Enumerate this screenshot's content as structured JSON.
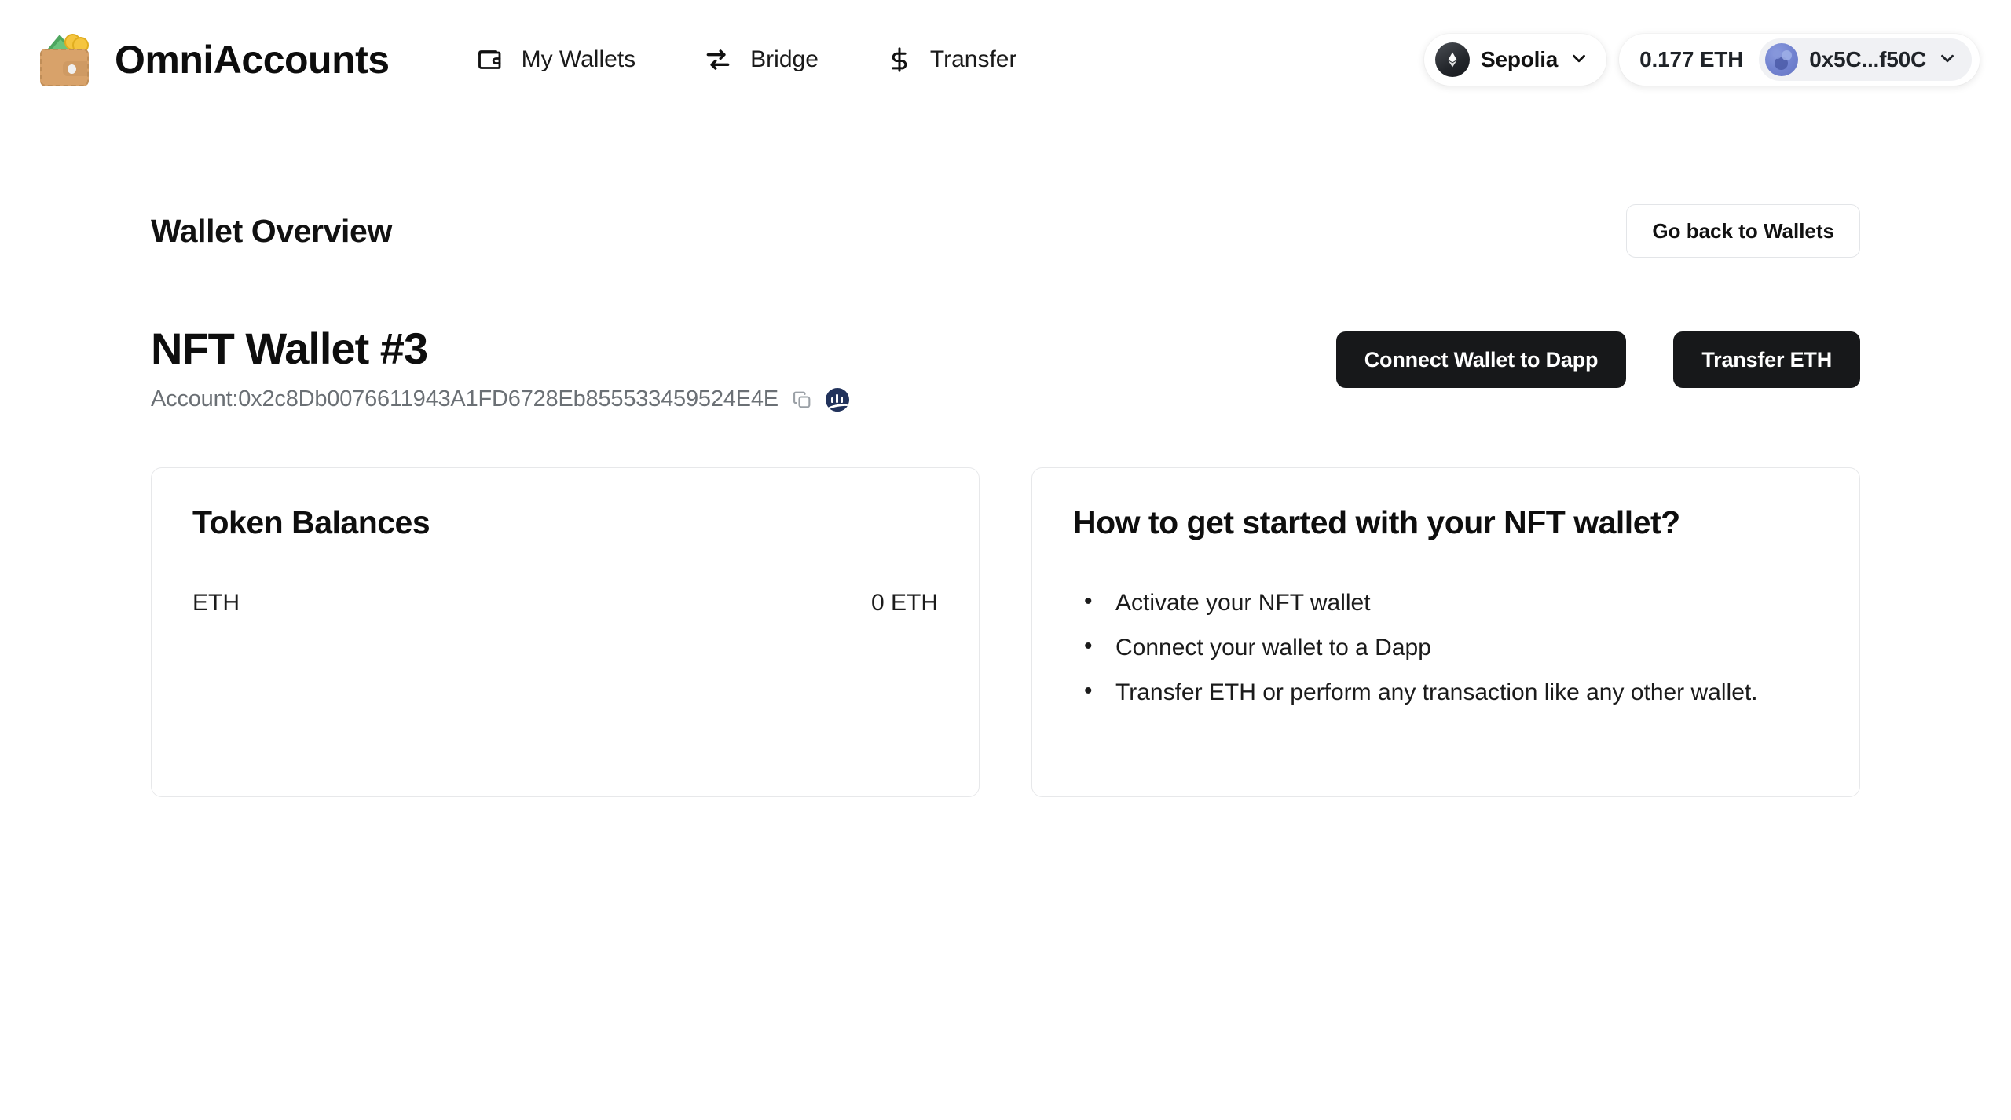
{
  "brand": {
    "name": "OmniAccounts",
    "logo_icon": "wallet-with-money-icon"
  },
  "nav": {
    "items": [
      {
        "label": "My Wallets",
        "icon": "wallet-icon"
      },
      {
        "label": "Bridge",
        "icon": "swap-arrows-icon"
      },
      {
        "label": "Transfer",
        "icon": "dollar-sign-icon"
      }
    ]
  },
  "header_right": {
    "network": {
      "label": "Sepolia",
      "icon": "ethereum-icon",
      "chevron": "chevron-down-icon"
    },
    "balance": "0.177 ETH",
    "account": {
      "label": "0x5C...f50C",
      "avatar": "jazzicon-avatar",
      "chevron": "chevron-down-icon"
    }
  },
  "overview": {
    "title": "Wallet Overview",
    "go_back_label": "Go back to Wallets"
  },
  "wallet": {
    "title": "NFT Wallet #3",
    "account_label": "Account:0x2c8Db0076611943A1FD6728Eb855533459524E4E",
    "copy_icon": "copy-icon",
    "explorer_icon": "etherscan-icon",
    "actions": {
      "connect_label": "Connect Wallet to Dapp",
      "transfer_label": "Transfer ETH"
    }
  },
  "token_balances": {
    "title": "Token Balances",
    "rows": [
      {
        "symbol": "ETH",
        "amount": "0 ETH"
      }
    ]
  },
  "getting_started": {
    "title": "How to get started with your NFT wallet?",
    "tips": [
      "Activate your NFT wallet",
      "Connect your wallet to a Dapp",
      "Transfer ETH or perform any transaction like any other wallet."
    ]
  },
  "colors": {
    "page_background": "#ffffff",
    "primary_button": "#17181a",
    "text_primary": "#111111",
    "text_muted": "#6b7075",
    "card_border": "#e7e8ea",
    "avatar_accent": "#7182cf",
    "etherscan_navy": "#21325b"
  }
}
